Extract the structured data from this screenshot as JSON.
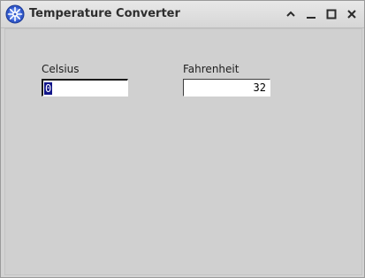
{
  "window": {
    "title": "Temperature Converter",
    "icon": "app-gear-icon",
    "controls": [
      "chevron-up-icon",
      "minimize-icon",
      "maximize-icon",
      "close-icon"
    ]
  },
  "celsius": {
    "label": "Celsius",
    "value": "0",
    "selected": true
  },
  "fahrenheit": {
    "label": "Fahrenheit",
    "value": "32"
  },
  "colors": {
    "window_bg": "#d0d0d0",
    "selection": "#12168a",
    "icon_blue": "#2f56c8"
  }
}
